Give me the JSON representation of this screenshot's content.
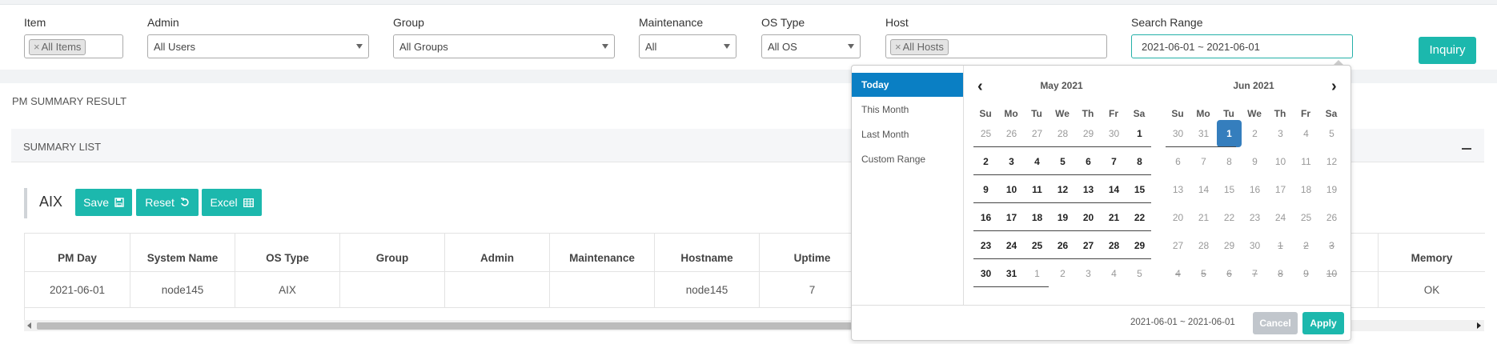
{
  "filters": {
    "item_label": "Item",
    "item_tag": "All Items",
    "admin_label": "Admin",
    "admin_value": "All Users",
    "group_label": "Group",
    "group_value": "All Groups",
    "maintenance_label": "Maintenance",
    "maintenance_value": "All",
    "os_label": "OS Type",
    "os_value": "All OS",
    "host_label": "Host",
    "host_tag": "All Hosts",
    "range_label": "Search Range",
    "range_value": "2021-06-01 ~ 2021-06-01",
    "tag_remove": "×",
    "inquiry_label": "Inquiry"
  },
  "result": {
    "title": "PM SUMMARY RESULT",
    "summary_title": "SUMMARY LIST",
    "os_name": "AIX",
    "save_label": "Save",
    "reset_label": "Reset",
    "excel_label": "Excel"
  },
  "table": {
    "headers": [
      "PM Day",
      "System Name",
      "OS Type",
      "Group",
      "Admin",
      "Maintenance",
      "Hostname",
      "Uptime",
      "Memory"
    ],
    "row": [
      "2021-06-01",
      "node145",
      "AIX",
      "",
      "",
      "",
      "node145",
      "7",
      "OK"
    ]
  },
  "picker": {
    "ranges": [
      "Today",
      "This Month",
      "Last Month",
      "Custom Range"
    ],
    "active_range": "Today",
    "left_title": "May 2021",
    "right_title": "Jun 2021",
    "weekdays": [
      "Su",
      "Mo",
      "Tu",
      "We",
      "Th",
      "Fr",
      "Sa"
    ],
    "left_days": [
      [
        "25",
        "26",
        "27",
        "28",
        "29",
        "30",
        "1"
      ],
      [
        "2",
        "3",
        "4",
        "5",
        "6",
        "7",
        "8"
      ],
      [
        "9",
        "10",
        "11",
        "12",
        "13",
        "14",
        "15"
      ],
      [
        "16",
        "17",
        "18",
        "19",
        "20",
        "21",
        "22"
      ],
      [
        "23",
        "24",
        "25",
        "26",
        "27",
        "28",
        "29"
      ],
      [
        "30",
        "31",
        "1",
        "2",
        "3",
        "4",
        "5"
      ]
    ],
    "right_days": [
      [
        "30",
        "31",
        "1",
        "2",
        "3",
        "4",
        "5"
      ],
      [
        "6",
        "7",
        "8",
        "9",
        "10",
        "11",
        "12"
      ],
      [
        "13",
        "14",
        "15",
        "16",
        "17",
        "18",
        "19"
      ],
      [
        "20",
        "21",
        "22",
        "23",
        "24",
        "25",
        "26"
      ],
      [
        "27",
        "28",
        "29",
        "30",
        "1",
        "2",
        "3"
      ],
      [
        "4",
        "5",
        "6",
        "7",
        "8",
        "9",
        "10"
      ]
    ],
    "selected_date": "2021-06-01",
    "footer_range": "2021-06-01 ~ 2021-06-01",
    "cancel_label": "Cancel",
    "apply_label": "Apply"
  }
}
